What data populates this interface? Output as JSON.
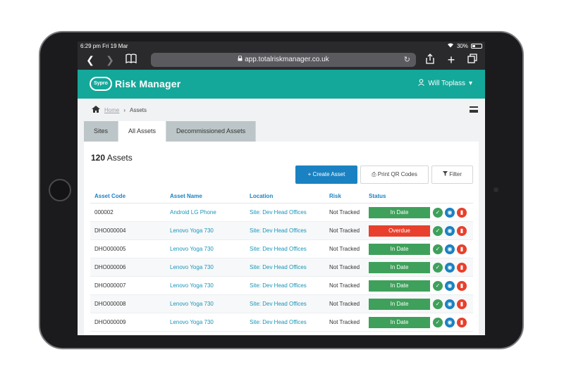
{
  "status_bar": {
    "time_date": "6:29 pm  Fri 19 Mar",
    "battery": "30%"
  },
  "browser": {
    "url": "app.totalriskmanager.co.uk"
  },
  "app": {
    "logo_text": "Sypro",
    "brand": "Risk Manager",
    "user": "Will Toplass"
  },
  "breadcrumb": {
    "home": "Home",
    "current": "Assets"
  },
  "tabs": [
    {
      "label": "Sites"
    },
    {
      "label": "All Assets"
    },
    {
      "label": "Decommissioned Assets"
    }
  ],
  "summary": {
    "count": "120",
    "label": "Assets"
  },
  "buttons": {
    "create": "Create Asset",
    "print": "Print QR Codes",
    "filter": "Filter"
  },
  "table": {
    "headers": [
      "Asset Code",
      "Asset Name",
      "Location",
      "Risk",
      "Status"
    ],
    "rows": [
      {
        "code": "000002",
        "name": "Android LG Phone",
        "location": "Site: Dev Head Offices",
        "risk": "Not Tracked",
        "status": "In Date"
      },
      {
        "code": "DHO000004",
        "name": "Lenovo Yoga 730",
        "location": "Site: Dev Head Offices",
        "risk": "Not Tracked",
        "status": "Overdue"
      },
      {
        "code": "DHO000005",
        "name": "Lenovo Yoga 730",
        "location": "Site: Dev Head Offices",
        "risk": "Not Tracked",
        "status": "In Date"
      },
      {
        "code": "DHO000006",
        "name": "Lenovo Yoga 730",
        "location": "Site: Dev Head Offices",
        "risk": "Not Tracked",
        "status": "In Date"
      },
      {
        "code": "DHO000007",
        "name": "Lenovo Yoga 730",
        "location": "Site: Dev Head Offices",
        "risk": "Not Tracked",
        "status": "In Date"
      },
      {
        "code": "DHO000008",
        "name": "Lenovo Yoga 730",
        "location": "Site: Dev Head Offices",
        "risk": "Not Tracked",
        "status": "In Date"
      },
      {
        "code": "DHO000009",
        "name": "Lenovo Yoga 730",
        "location": "Site: Dev Head Offices",
        "risk": "Not Tracked",
        "status": "In Date"
      }
    ]
  },
  "colors": {
    "header": "#14a89a",
    "primary": "#1a82c2",
    "in_date": "#3fa05b",
    "overdue": "#e8402c"
  },
  "icons": [
    "wifi-icon",
    "battery-icon",
    "back-icon",
    "forward-icon",
    "bookmarks-icon",
    "lock-icon",
    "reload-icon",
    "share-icon",
    "new-tab-icon",
    "tabs-icon",
    "user-icon",
    "caret-down-icon",
    "home-icon",
    "menu-icon",
    "plus-icon",
    "print-icon",
    "filter-icon",
    "check-icon",
    "eye-icon",
    "trash-icon"
  ]
}
